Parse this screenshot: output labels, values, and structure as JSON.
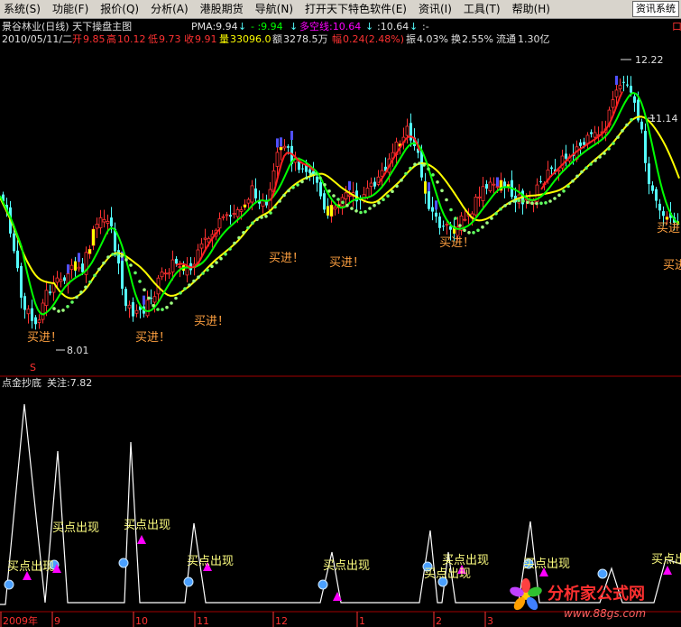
{
  "menu": {
    "items": [
      "系统(S)",
      "功能(F)",
      "报价(Q)",
      "分析(A)",
      "港股期货",
      "导航(N)",
      "打开天下特色软件(E)",
      "资讯(I)",
      "工具(T)",
      "帮助(H)"
    ],
    "system_button": "资讯系统"
  },
  "header": {
    "title": "景谷林业(日线) 天下操盘主图",
    "pma_label": "PMA:9.94",
    "pma_arrow": "↓",
    "ind2": "-  :9.94",
    "ind2_arrow": "↓",
    "duokong": "多空线:10.64",
    "duokong_arrow": "↓",
    "ind4": ":10.64",
    "ind4_arrow": "↓",
    "ind5": ":-",
    "right_char": "口"
  },
  "quote": {
    "date": "2010/05/11/二",
    "open_label": "开",
    "open": "9.85",
    "high_label": "高",
    "high": "10.12",
    "low_label": "低",
    "low": "9.73",
    "close_label": "收",
    "close": "9.91",
    "vol_label": "量",
    "vol": "33096.0",
    "amt_label": "额",
    "amt": "3278.5万",
    "chg_label": "幅",
    "chg": "0.24(2.48%)",
    "amp_label": "振",
    "amp": "4.03%",
    "turn_label": "换",
    "turn": "2.55%",
    "float_label": "流通",
    "float": "1.30亿"
  },
  "main_chart": {
    "price_labels": [
      "12.22",
      "11.14",
      "8.01"
    ],
    "buy_signal": "买进！",
    "s_marker": "S"
  },
  "sub_chart": {
    "title": "点金抄底",
    "focus": "关注:7.82",
    "signal_text": "买点出现"
  },
  "x_axis": {
    "labels": [
      "2009年",
      "9",
      "10",
      "11",
      "12",
      "1",
      "2",
      "3"
    ]
  },
  "watermark": {
    "brand": "分析家公式网",
    "url": "www.88gs.com"
  },
  "colors": {
    "up": "#ff3232",
    "down": "#54fcfc",
    "ma_yellow": "#ffff00",
    "ma_green": "#00ff00",
    "duokong": "#ff00ff",
    "signal_magenta": "#ff00ff",
    "label_orange": "#ffa040"
  }
}
